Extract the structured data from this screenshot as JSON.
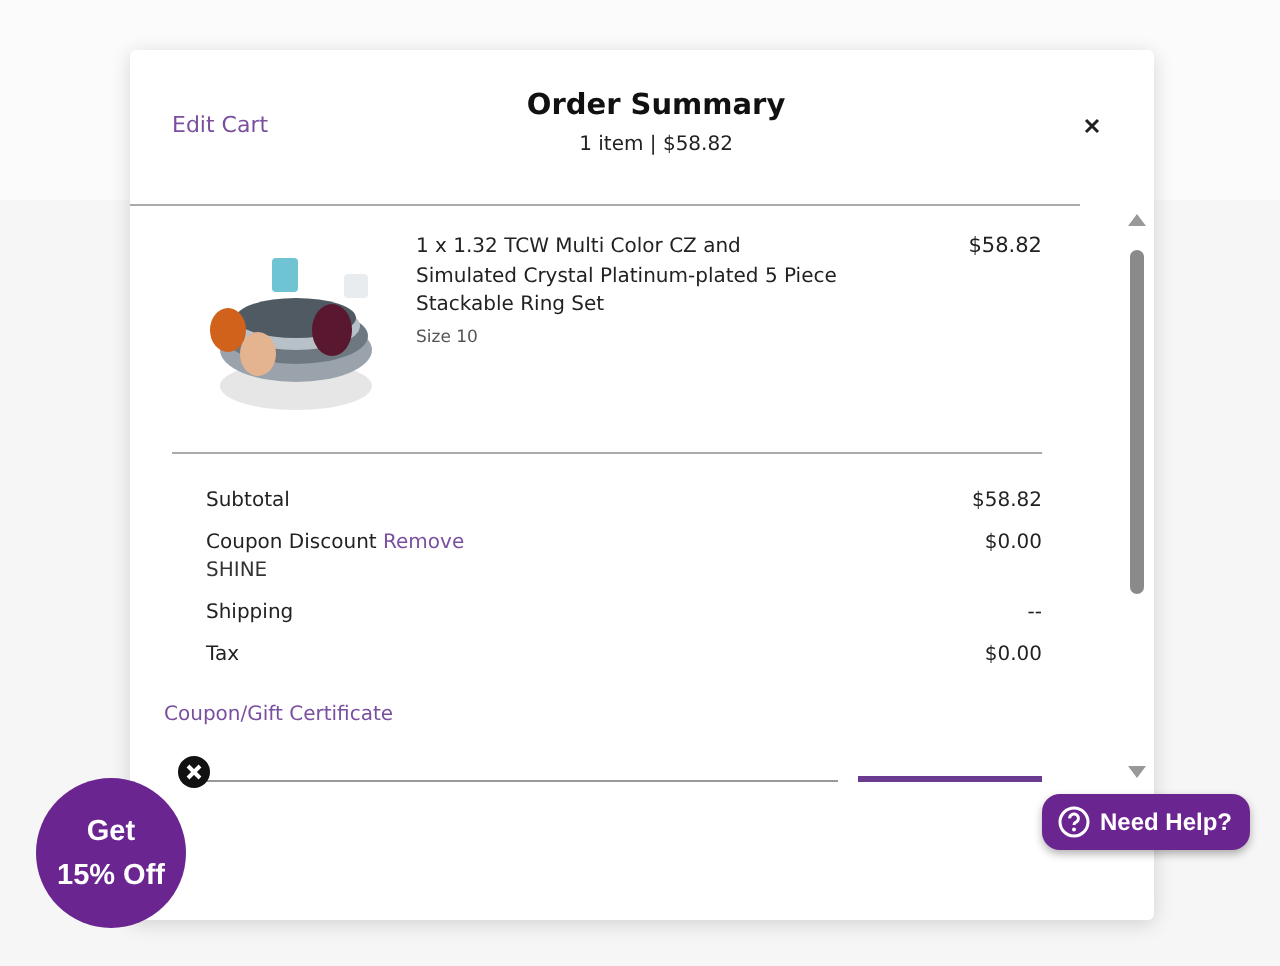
{
  "modal": {
    "edit_link": "Edit Cart",
    "title": "Order Summary",
    "subtitle": "1 item | $58.82",
    "items": [
      {
        "kind": "picture",
        "name": "1 x 1.32 TCW Multi Color CZ and Simulated Crystal Platinum-plated 5 Piece Stackable Ring Set",
        "size": "Size 10",
        "price": "$58.82"
      }
    ],
    "totals": [
      {
        "label": "Subtotal",
        "value": "$58.82"
      },
      {
        "label": "Coupon Discount",
        "action": "Remove",
        "code": "SHINE",
        "value": "$0.00"
      },
      {
        "label": "Shipping",
        "value": "--"
      },
      {
        "label": "Tax",
        "value": "$0.00"
      }
    ],
    "coupon_link": "Coupon/Gift Certificate"
  },
  "promo": {
    "line1": "Get",
    "line2": "15% Off"
  },
  "help_button": "Need Help?"
}
